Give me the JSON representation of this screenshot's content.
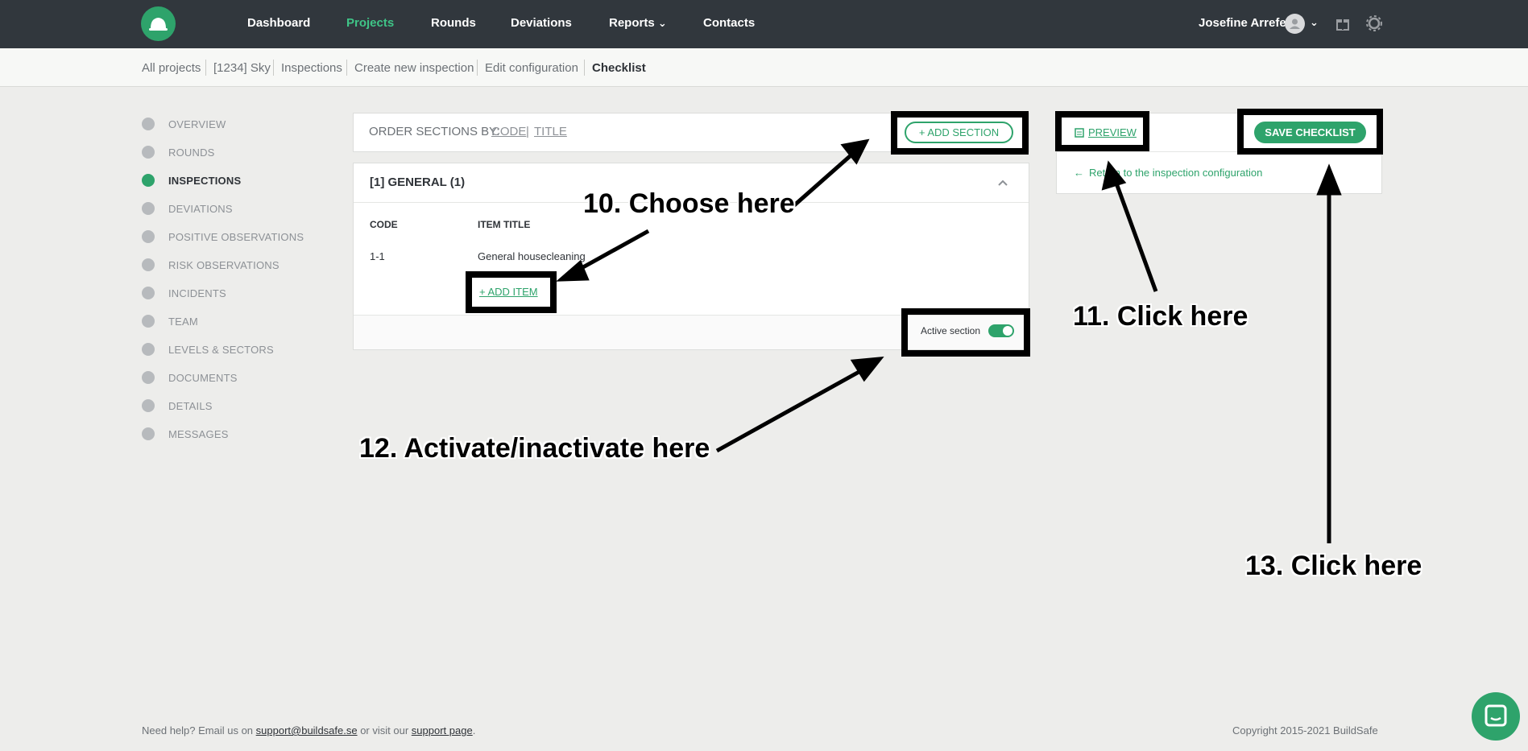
{
  "nav": {
    "items": [
      "Dashboard",
      "Projects",
      "Rounds",
      "Deviations",
      "Reports",
      "Contacts"
    ],
    "reports_caret": "⌄",
    "user_name": "Josefine Arrefelt",
    "user_caret": "⌄"
  },
  "breadcrumb": [
    "All projects",
    "[1234] Sky",
    "Inspections",
    "Create new inspection",
    "Edit configuration",
    "Checklist"
  ],
  "sidebar": {
    "items": [
      "OVERVIEW",
      "ROUNDS",
      "INSPECTIONS",
      "DEVIATIONS",
      "POSITIVE OBSERVATIONS",
      "RISK OBSERVATIONS",
      "INCIDENTS",
      "TEAM",
      "LEVELS & SECTORS",
      "DOCUMENTS",
      "DETAILS",
      "MESSAGES"
    ]
  },
  "order": {
    "label": "ORDER SECTIONS BY:",
    "code": "CODE",
    "separator": "|",
    "title": "TITLE"
  },
  "buttons": {
    "add_section": "+  ADD SECTION",
    "preview": "PREVIEW",
    "save_checklist": "SAVE CHECKLIST",
    "add_item": "+  ADD ITEM"
  },
  "return_link": "Return to the inspection configuration",
  "section": {
    "title": "[1] GENERAL (1)",
    "col_code": "CODE",
    "col_title": "ITEM TITLE",
    "row_code": "1-1",
    "row_title": "General housecleaning",
    "active_label": "Active section"
  },
  "annotations": {
    "a10": "10. Choose here",
    "a11": "11. Click here",
    "a12": "12. Activate/inactivate here",
    "a13": "13. Click here"
  },
  "footer": {
    "prefix": "Need help? Email us on ",
    "email": "support@buildsafe.se",
    "middle": " or visit our ",
    "support": "support page",
    "suffix": ".",
    "copyright": "Copyright 2015-2021 BuildSafe"
  },
  "colors": {
    "accent": "#2ea36b",
    "topbar": "#31373d",
    "background": "#ededeb"
  }
}
